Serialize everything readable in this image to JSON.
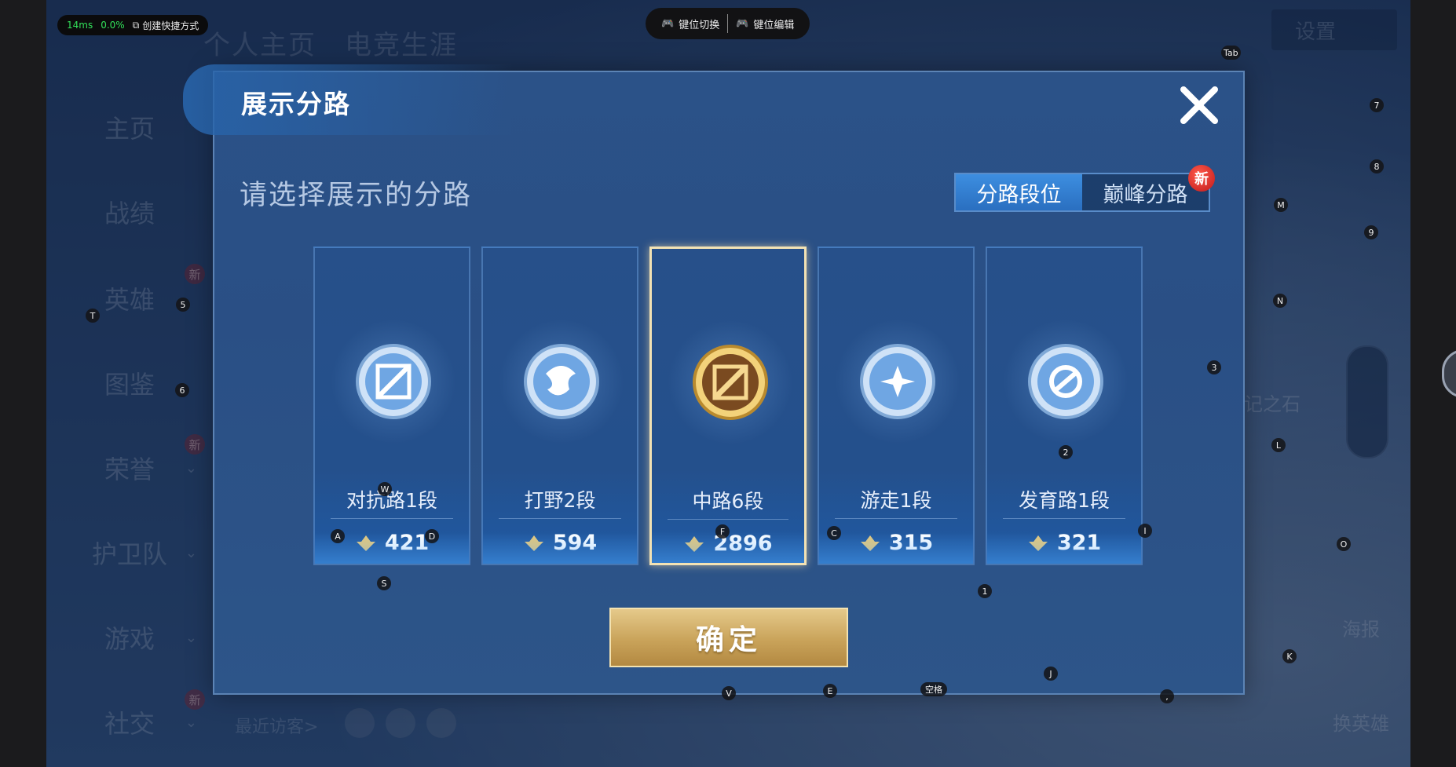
{
  "status": {
    "latency": "14ms",
    "loss": "0.0%",
    "shortcut_label": "创建快捷方式"
  },
  "keymap": {
    "switch_label": "键位切换",
    "edit_label": "键位编辑"
  },
  "background": {
    "tabs": [
      "个人主页",
      "电竞生涯"
    ],
    "sidebar": [
      {
        "label": "主页"
      },
      {
        "label": "战绩"
      },
      {
        "label": "英雄"
      },
      {
        "label": "图鉴"
      },
      {
        "label": "荣誉"
      },
      {
        "label": "护卫队"
      },
      {
        "label": "游戏"
      },
      {
        "label": "社交"
      }
    ],
    "new_badge": "新",
    "visitors_label": "最近访客>",
    "settings_label": "设置",
    "right_stone_label": "记之石",
    "poster_label": "海报",
    "swap_hero_label": "换英雄"
  },
  "dialog": {
    "title": "展示分路",
    "subtitle": "请选择展示的分路",
    "tabs": [
      {
        "label": "分路段位",
        "active": true
      },
      {
        "label": "巅峰分路",
        "active": false
      }
    ],
    "new_badge": "新",
    "lanes": [
      {
        "name": "对抗路1段",
        "score": "421",
        "icon": "clash-lane-emblem-icon",
        "selected": false
      },
      {
        "name": "打野2段",
        "score": "594",
        "icon": "jungle-dragon-emblem-icon",
        "selected": false
      },
      {
        "name": "中路6段",
        "score": "2896",
        "icon": "mid-lane-emblem-icon",
        "selected": true
      },
      {
        "name": "游走1段",
        "score": "315",
        "icon": "roam-wings-emblem-icon",
        "selected": false
      },
      {
        "name": "发育路1段",
        "score": "321",
        "icon": "farm-lane-emblem-icon",
        "selected": false
      }
    ],
    "confirm_label": "确定"
  },
  "key_hints": [
    "Tab",
    "7",
    "8",
    "M",
    "9",
    "N",
    "3",
    "T",
    "5",
    "6",
    "W",
    "A",
    "D",
    "F",
    "C",
    "2",
    "L",
    "I",
    "O",
    "S",
    "1",
    "J",
    "K",
    "V",
    "E",
    "空格",
    ","
  ],
  "colors": {
    "accent_blue": "#2a6fc0",
    "gold": "#c9a35a",
    "badge_red": "#d62020"
  }
}
